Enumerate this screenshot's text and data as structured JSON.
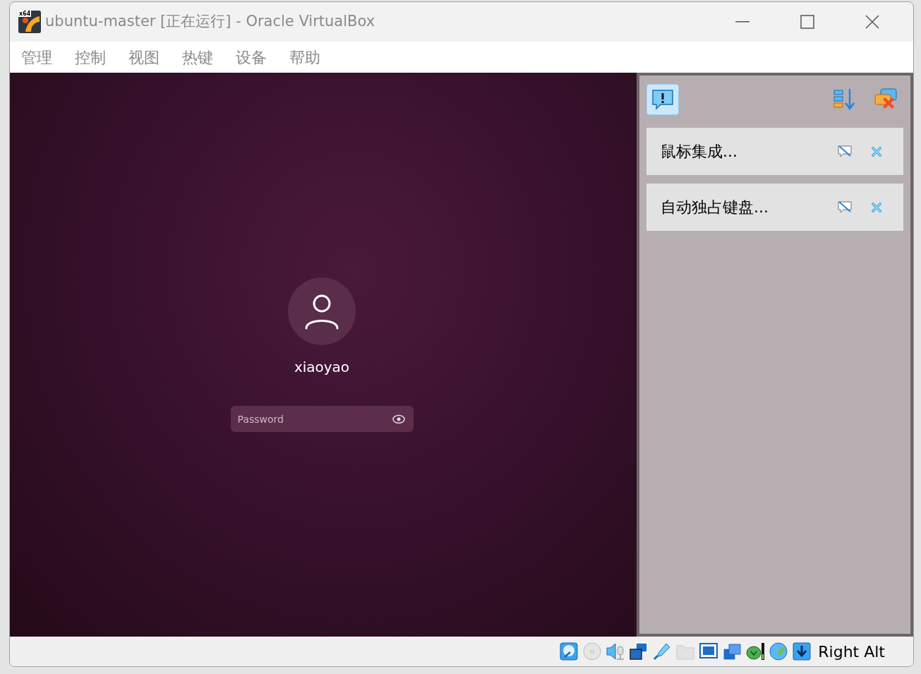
{
  "window": {
    "badge": "x64",
    "title": "ubuntu-master [正在运行] - Oracle VirtualBox"
  },
  "menu": [
    "管理",
    "控制",
    "视图",
    "热键",
    "设备",
    "帮助"
  ],
  "login": {
    "username": "xiaoyao",
    "password": {
      "placeholder": "Password"
    }
  },
  "notification_center": {
    "toggle_selected": true,
    "items": [
      {
        "text": "鼠标集成..."
      },
      {
        "text": "自动独占键盘..."
      }
    ]
  },
  "status_bar": {
    "host_key": "Right Alt"
  }
}
